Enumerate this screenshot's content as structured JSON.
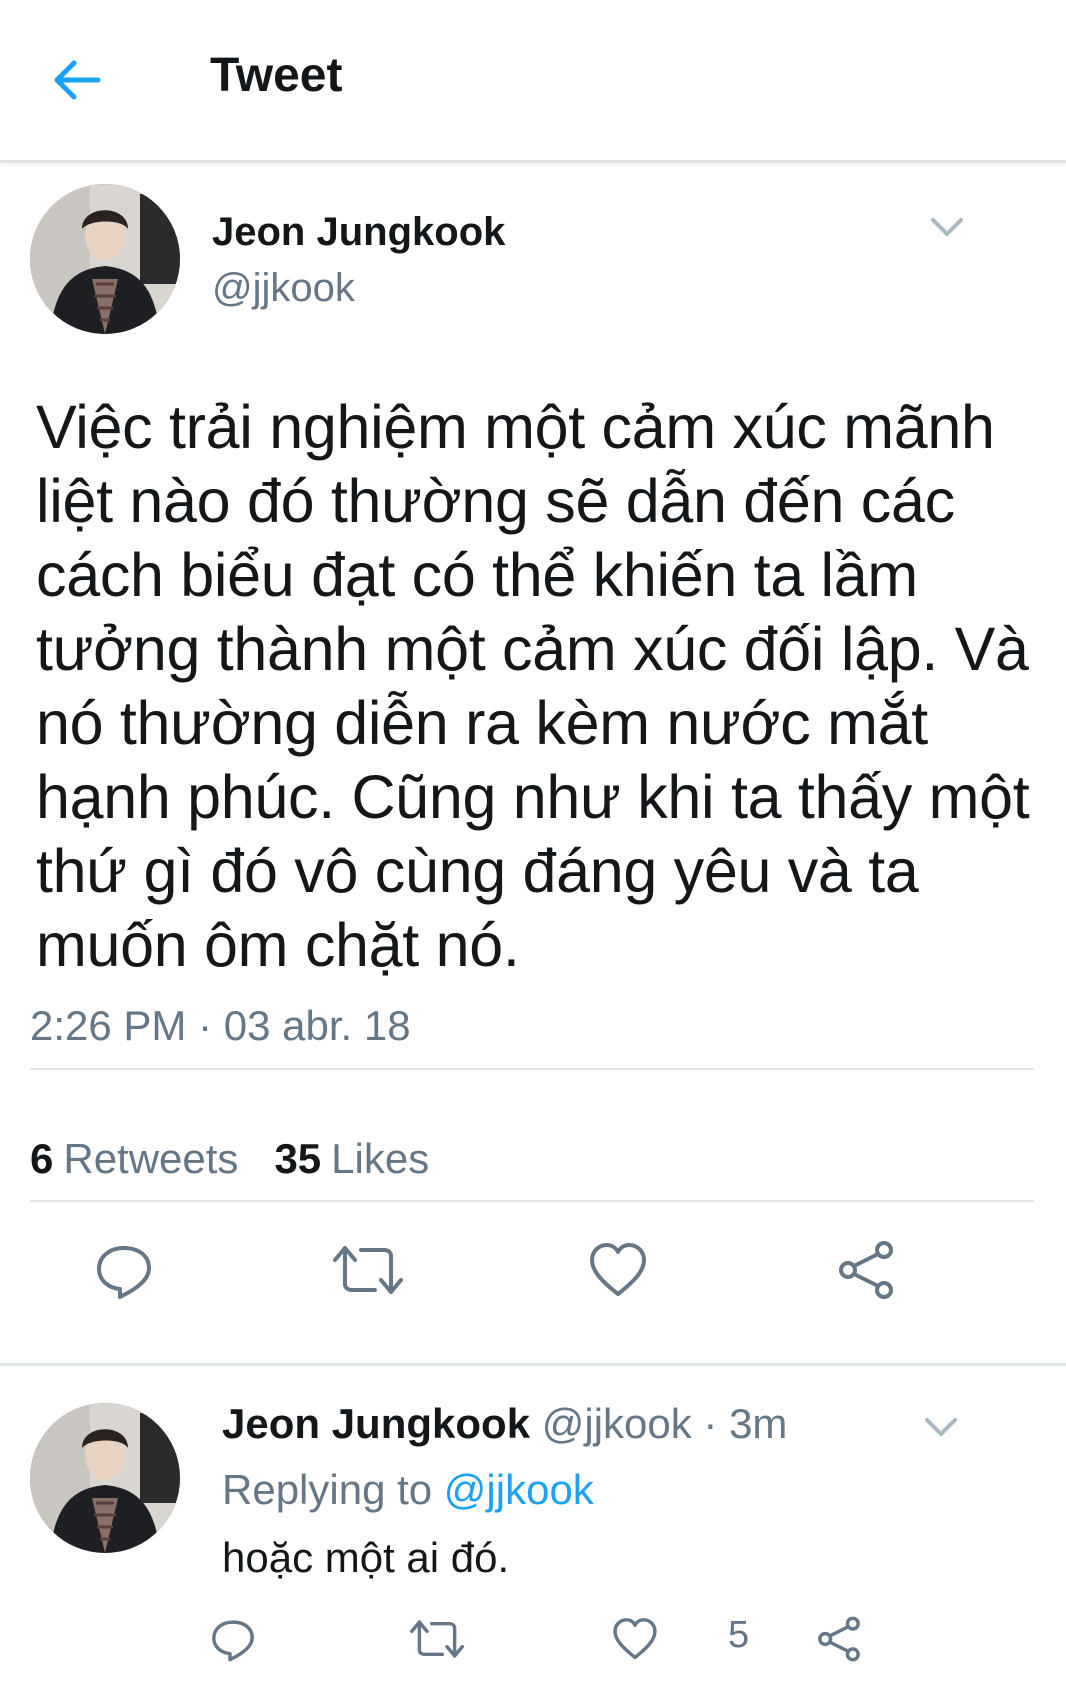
{
  "header": {
    "title": "Tweet",
    "back_icon": "arrow-left-icon"
  },
  "colors": {
    "accent": "#1da1f2",
    "secondary_text": "#657786",
    "divider": "#e1e5e8"
  },
  "tweet": {
    "author_name": "Jeon Jungkook",
    "author_handle": "@jjkook",
    "text": "Việc trải nghiệm một cảm xúc mãnh liệt nào đó thường sẽ dẫn đến các cách biểu đạt có thể khiến ta lầm tưởng thành một cảm xúc đối lập. Và nó thường diễn ra kèm nước mắt hạnh phúc. Cũng như khi ta thấy một thứ gì đó vô cùng đáng yêu và ta muốn ôm chặt nó.",
    "timestamp": "2:26 PM · 03 abr. 18",
    "retweets_count": "6",
    "retweets_label": "Retweets",
    "likes_count": "35",
    "likes_label": "Likes",
    "actions": [
      "reply-icon",
      "retweet-icon",
      "like-icon",
      "share-icon"
    ]
  },
  "reply": {
    "author_name": "Jeon Jungkook",
    "meta": "@jjkook · 3m",
    "replying_prefix": "Replying to",
    "replying_to": "@jjkook",
    "text": "hoặc một ai đó.",
    "like_count": "5",
    "actions": [
      "reply-icon",
      "retweet-icon",
      "like-icon",
      "share-icon"
    ]
  }
}
